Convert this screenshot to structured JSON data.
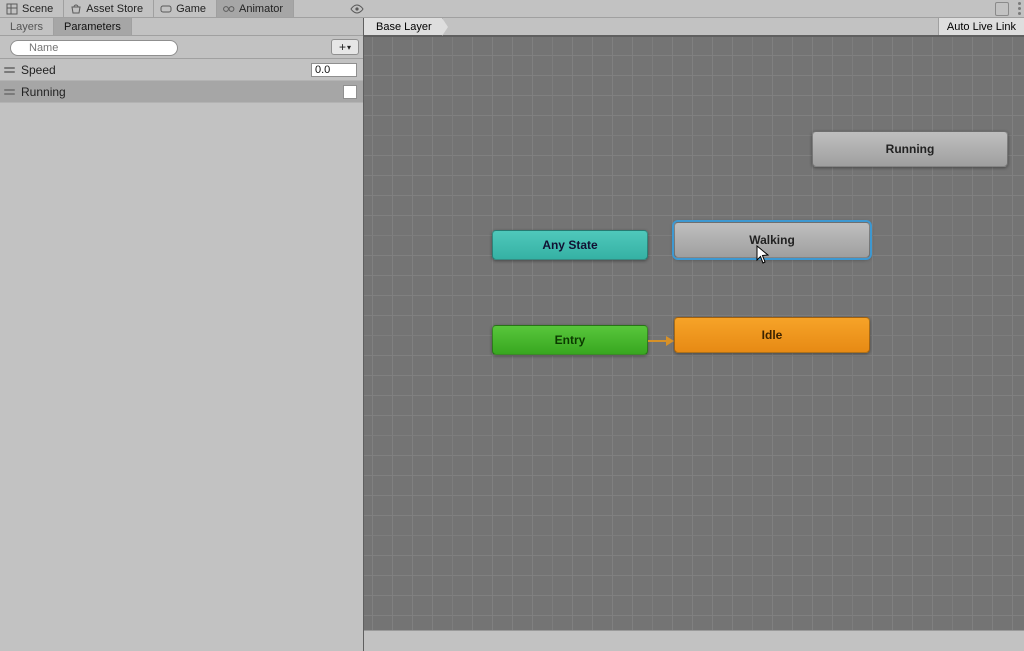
{
  "tabs": {
    "scene": "Scene",
    "asset_store": "Asset Store",
    "game": "Game",
    "animator": "Animator"
  },
  "subtabs": {
    "layers": "Layers",
    "parameters": "Parameters"
  },
  "search": {
    "placeholder": "Name"
  },
  "add_button": {
    "label": "+"
  },
  "parameters": [
    {
      "name": "Speed",
      "value": "0.0",
      "type": "float"
    },
    {
      "name": "Running",
      "type": "bool"
    }
  ],
  "breadcrumb": "Base Layer",
  "autolive": "Auto Live Link",
  "nodes": {
    "any_state": "Any State",
    "entry": "Entry",
    "walking": "Walking",
    "idle": "Idle",
    "running": "Running"
  }
}
